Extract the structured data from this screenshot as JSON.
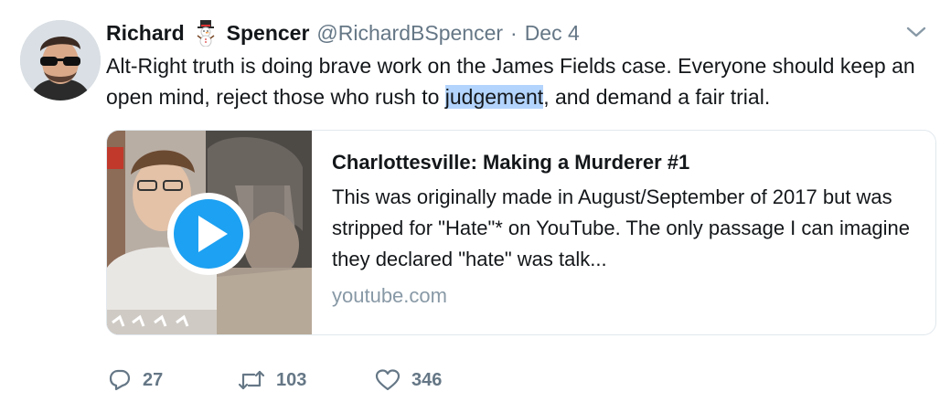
{
  "tweet": {
    "author_name_first": "Richard",
    "author_name_last": "Spencer",
    "handle": "@RichardBSpencer",
    "separator": "·",
    "date": "Dec 4",
    "text_before": "Alt-Right truth is doing brave work on the James Fields case. Everyone should keep an open mind, reject those who rush to ",
    "text_highlighted": "judgement",
    "text_after": ", and demand a fair trial."
  },
  "card": {
    "title": "Charlottesville: Making a Murderer #1",
    "description": "This was originally made in August/September of 2017 but was stripped for \"Hate\"* on YouTube. The only passage I can imagine they declared \"hate\" was talk...",
    "domain": "youtube.com"
  },
  "actions": {
    "replies": "27",
    "retweets": "103",
    "likes": "346"
  },
  "colors": {
    "text": "#14171a",
    "secondary": "#657786",
    "border": "#e1e8ed",
    "highlight": "#b3d4fc",
    "play_button": "#1da1f2"
  },
  "icons": [
    "snowman-emoji-icon",
    "chevron-down-icon",
    "play-icon",
    "reply-icon",
    "retweet-icon",
    "like-icon"
  ]
}
